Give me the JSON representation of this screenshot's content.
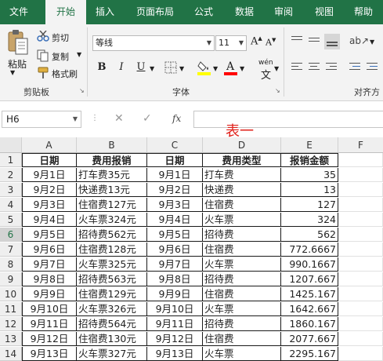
{
  "ribbon_tabs": [
    "文件",
    "开始",
    "插入",
    "页面布局",
    "公式",
    "数据",
    "审阅",
    "视图",
    "帮助"
  ],
  "clipboard": {
    "paste": "粘贴",
    "cut": "剪切",
    "copy": "复制",
    "format_painter": "格式刷",
    "group_label": "剪贴板"
  },
  "font": {
    "name": "等线",
    "size": "11",
    "group_label": "字体",
    "bold": "B",
    "italic": "I",
    "underline": "U",
    "phonetic": "wén"
  },
  "alignment": {
    "group_label": "对齐方"
  },
  "namebox": "H6",
  "formula_fx": "fx",
  "annotation": "表一",
  "colors": {
    "ribbon_green": "#217346",
    "font_color_red": "#ff0000",
    "fill_yellow": "#ffff00",
    "annotation_red": "#e0201a"
  },
  "columns": [
    "A",
    "B",
    "C",
    "D",
    "E",
    "F"
  ],
  "rows": [
    "1",
    "2",
    "3",
    "4",
    "5",
    "6",
    "7",
    "8",
    "9",
    "10",
    "11",
    "12",
    "13",
    "14"
  ],
  "table": {
    "headers": [
      "日期",
      "费用报销",
      "日期",
      "费用类型",
      "报销金额"
    ],
    "rows": [
      [
        "9月1日",
        "打车费35元",
        "9月1日",
        "打车费",
        "35"
      ],
      [
        "9月2日",
        "快递费13元",
        "9月2日",
        "快递费",
        "13"
      ],
      [
        "9月3日",
        "住宿费127元",
        "9月3日",
        "住宿费",
        "127"
      ],
      [
        "9月4日",
        "火车票324元",
        "9月4日",
        "火车票",
        "324"
      ],
      [
        "9月5日",
        "招待费562元",
        "9月5日",
        "招待费",
        "562"
      ],
      [
        "9月6日",
        "住宿费128元",
        "9月6日",
        "住宿费",
        "772.6667"
      ],
      [
        "9月7日",
        "火车票325元",
        "9月7日",
        "火车票",
        "990.1667"
      ],
      [
        "9月8日",
        "招待费563元",
        "9月8日",
        "招待费",
        "1207.667"
      ],
      [
        "9月9日",
        "住宿费129元",
        "9月9日",
        "住宿费",
        "1425.167"
      ],
      [
        "9月10日",
        "火车票326元",
        "9月10日",
        "火车票",
        "1642.667"
      ],
      [
        "9月11日",
        "招待费564元",
        "9月11日",
        "招待费",
        "1860.167"
      ],
      [
        "9月12日",
        "住宿费130元",
        "9月12日",
        "住宿费",
        "2077.667"
      ],
      [
        "9月13日",
        "火车票327元",
        "9月13日",
        "火车票",
        "2295.167"
      ]
    ]
  }
}
